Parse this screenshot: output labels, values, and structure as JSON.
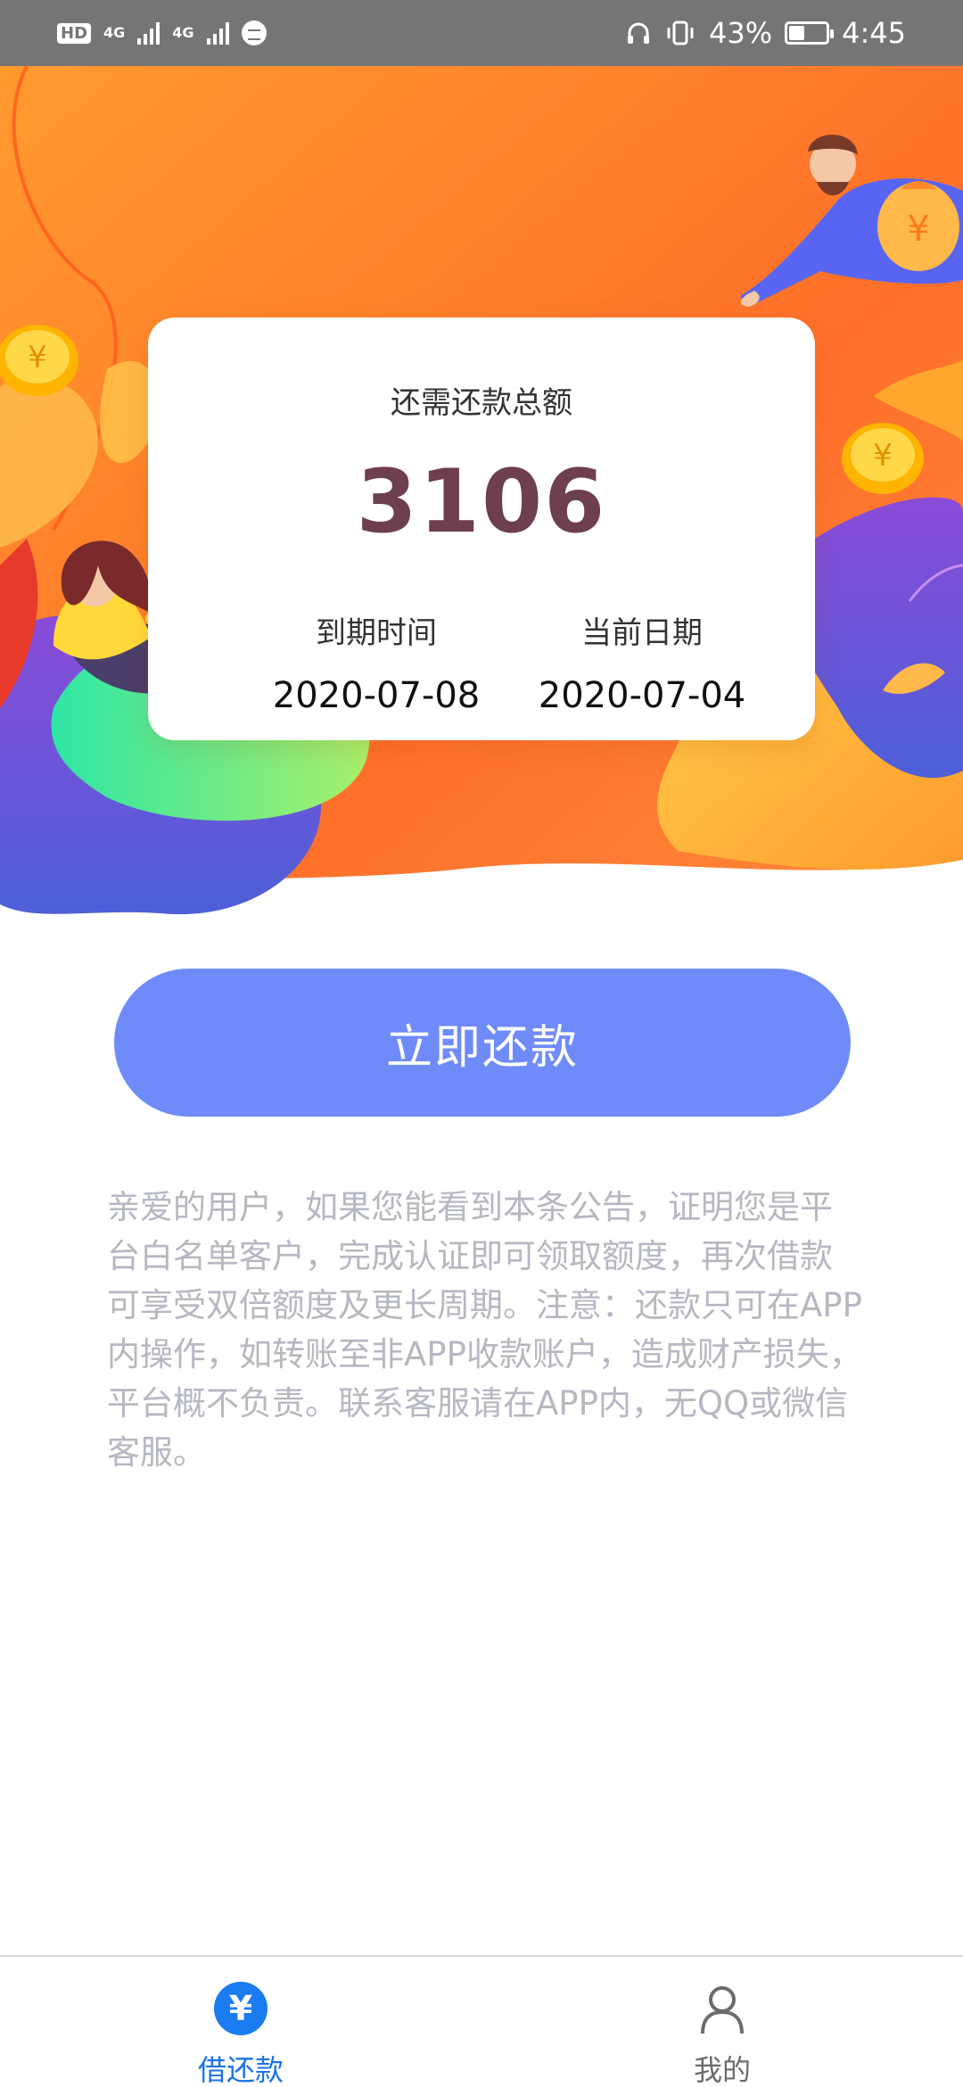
{
  "status_bar": {
    "hd": "HD",
    "network_1": "4G",
    "network_2": "4G",
    "battery_percent": "43%",
    "battery_level": 0.43,
    "time": "4:45"
  },
  "card": {
    "title": "还需还款总额",
    "amount": "3106",
    "due_label": "到期时间",
    "due_value": "2020-07-08",
    "current_label": "当前日期",
    "current_value": "2020-07-04"
  },
  "repay_button_label": "立即还款",
  "notice": "亲爱的用户，如果您能看到本条公告，证明您是平台白名单客户，完成认证即可领取额度，再次借款可享受双倍额度及更长周期。注意：还款只可在APP内操作，如转账至非APP收款账户，造成财产损失，平台概不负责。联系客服请在APP内，无QQ或微信客服。",
  "bottom_nav": {
    "items": [
      {
        "label": "借还款",
        "icon": "yen-icon",
        "active": true
      },
      {
        "label": "我的",
        "icon": "person-icon",
        "active": false
      }
    ]
  },
  "colors": {
    "accent": "#1a73e8",
    "button": "#6f8bfa",
    "amount": "#6e3f4c",
    "hero_orange": "#ff7a2a"
  }
}
